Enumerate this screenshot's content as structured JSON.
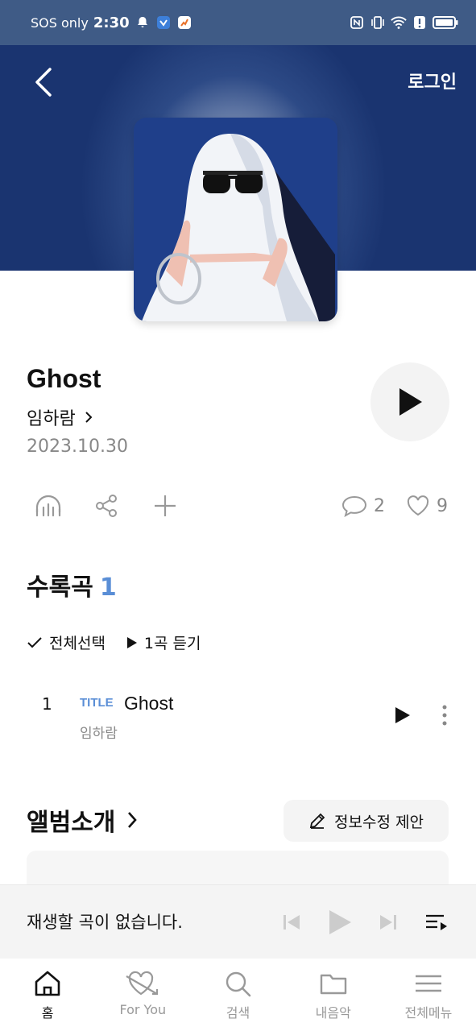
{
  "status_bar": {
    "carrier": "SOS only",
    "time": "2:30"
  },
  "header": {
    "login": "로그인"
  },
  "album": {
    "title": "Ghost",
    "artist": "임하람",
    "release_date": "2023.10.30",
    "comment_count": "2",
    "like_count": "9"
  },
  "tracklist": {
    "heading": "수록곡",
    "count": "1",
    "select_all": "전체선택",
    "play_label": "1곡 듣기",
    "tracks": [
      {
        "number": "1",
        "badge": "TITLE",
        "name": "Ghost",
        "artist": "임하람"
      }
    ]
  },
  "intro": {
    "heading": "앨범소개",
    "edit_suggest": "정보수정 제안"
  },
  "mini_player": {
    "message": "재생할 곡이 없습니다."
  },
  "bottom_nav": {
    "items": [
      {
        "label": "홈",
        "icon": "home-icon"
      },
      {
        "label": "For You",
        "icon": "heart-arrow-icon"
      },
      {
        "label": "검색",
        "icon": "search-icon"
      },
      {
        "label": "내음악",
        "icon": "folder-icon"
      },
      {
        "label": "전체메뉴",
        "icon": "menu-icon"
      }
    ]
  },
  "colors": {
    "accent": "#5a8ed6",
    "header_bg": "#1a3470",
    "status_bar_bg": "#3f5b86"
  }
}
